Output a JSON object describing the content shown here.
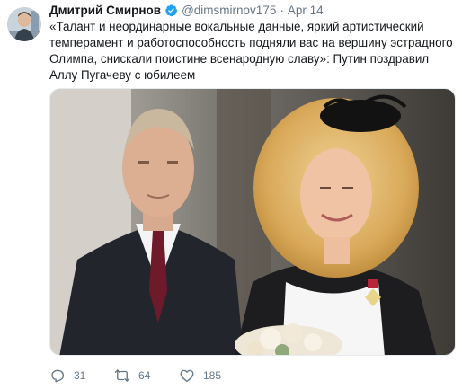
{
  "tweet": {
    "author": {
      "name": "Дмитрий Смирнов",
      "handle": "@dimsmirnov175",
      "verified": true
    },
    "separator": "·",
    "date": "Apr 14",
    "text": "«Талант и неординарные вокальные данные, яркий артистический темперамент и работоспособность подняли вас на вершину эстрадного Олимпа, снискали поистине всенародную славу»: Путин поздравил Аллу Пугачеву с юбилеем",
    "actions": {
      "replies": "31",
      "retweets": "64",
      "likes": "185"
    }
  },
  "colors": {
    "text": "#14171a",
    "secondary": "#657786",
    "verified": "#1da1f2"
  },
  "icons": [
    "avatar",
    "verified-badge-icon",
    "reply-icon",
    "retweet-icon",
    "like-icon"
  ]
}
